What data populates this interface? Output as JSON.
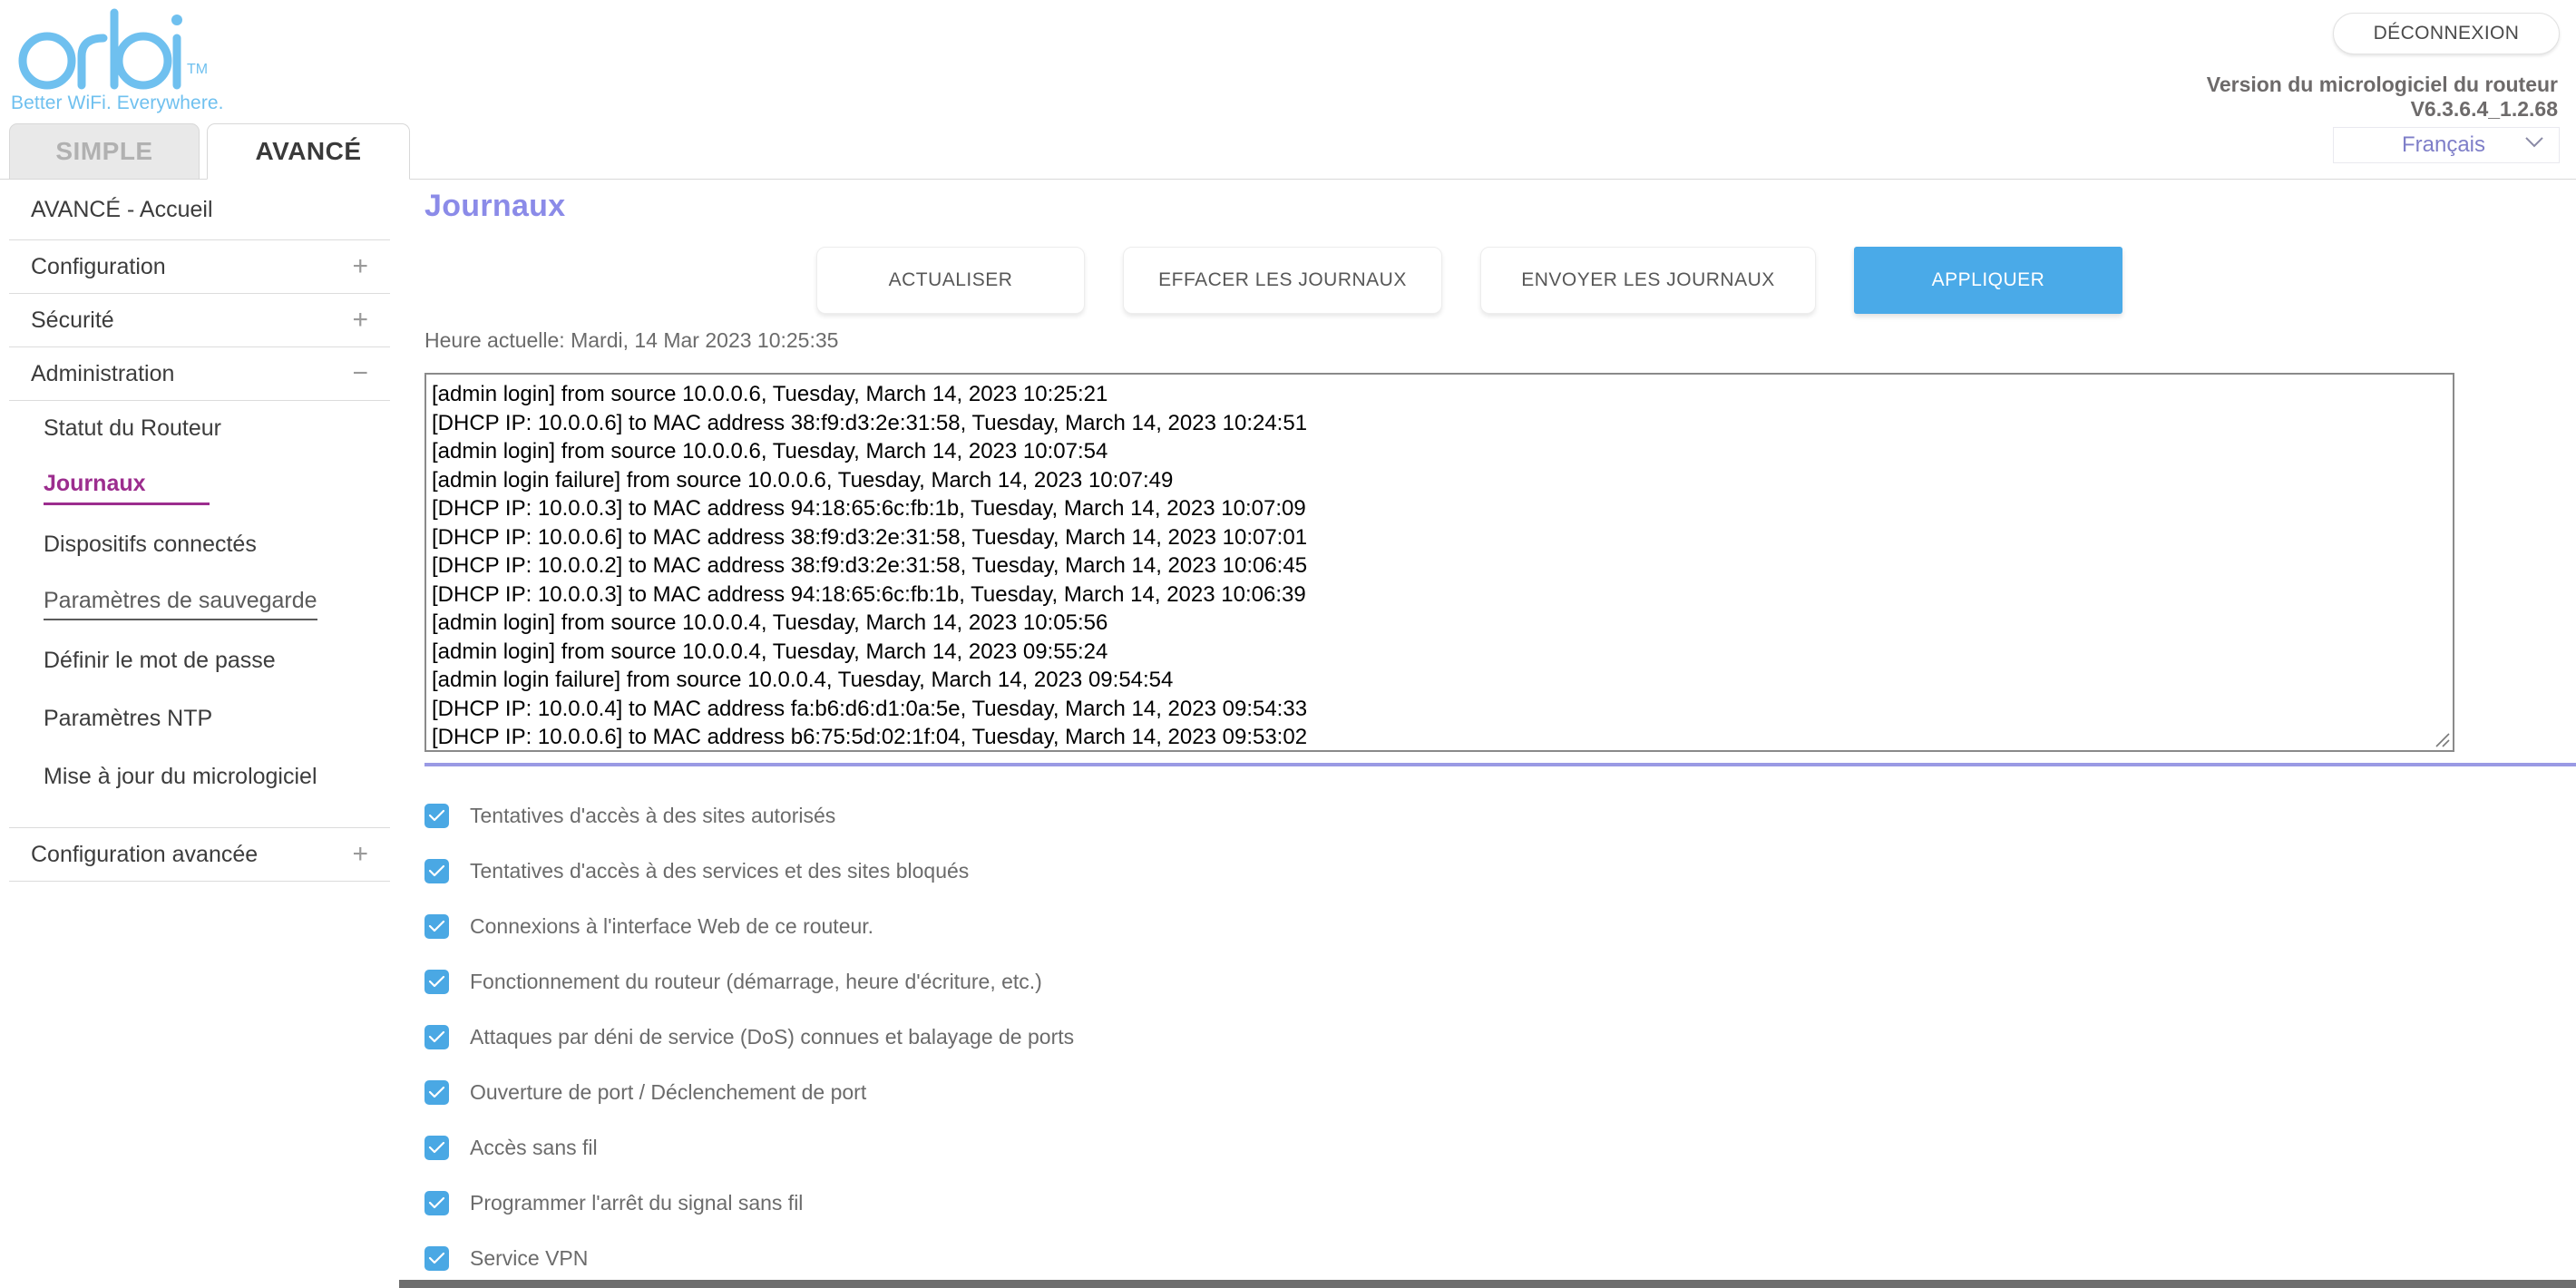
{
  "header": {
    "logo_text": "orbi",
    "logo_tm": "TM",
    "tagline": "Better WiFi. Everywhere.",
    "logout_label": "DÉCONNEXION",
    "firmware_label": "Version du micrologiciel du routeur",
    "firmware_version": "V6.3.6.4_1.2.68",
    "language_selected": "Français",
    "chevron": "⌄",
    "accent_blue": "#6fc0ef"
  },
  "tabs": [
    {
      "label": "SIMPLE",
      "active": false
    },
    {
      "label": "AVANCÉ",
      "active": true
    }
  ],
  "sidebar": {
    "home_label": "AVANCÉ - Accueil",
    "groups": [
      {
        "label": "Configuration",
        "sign": "+"
      },
      {
        "label": "Sécurité",
        "sign": "+"
      },
      {
        "label": "Administration",
        "sign": "−"
      }
    ],
    "admin_items": [
      {
        "label": "Statut du Routeur",
        "state": "normal"
      },
      {
        "label": "Journaux",
        "state": "active"
      },
      {
        "label": "Dispositifs connectés",
        "state": "normal"
      },
      {
        "label": "Paramètres de sauvegarde",
        "state": "hover"
      },
      {
        "label": "Définir le mot de passe",
        "state": "normal"
      },
      {
        "label": "Paramètres NTP",
        "state": "normal"
      },
      {
        "label": "Mise à jour du micrologiciel",
        "state": "normal"
      }
    ],
    "advanced_group": {
      "label": "Configuration avancée",
      "sign": "+"
    },
    "active_color": "#9c2d8e"
  },
  "main": {
    "page_title": "Journaux",
    "page_title_color": "#8b8be8",
    "buttons": [
      {
        "label": "ACTUALISER",
        "primary": false,
        "width_class": "w1"
      },
      {
        "label": "EFFACER LES JOURNAUX",
        "primary": false,
        "width_class": "w2"
      },
      {
        "label": "ENVOYER LES JOURNAUX",
        "primary": false,
        "width_class": "w3"
      },
      {
        "label": "APPLIQUER",
        "primary": true,
        "width_class": "w1"
      }
    ],
    "primary_button_color": "#4aaae8",
    "current_time": "Heure actuelle: Mardi, 14 Mar 2023 10:25:35",
    "log_lines": [
      "[admin login] from source 10.0.0.6, Tuesday, March 14, 2023 10:25:21",
      "[DHCP IP: 10.0.0.6] to MAC address 38:f9:d3:2e:31:58, Tuesday, March 14, 2023 10:24:51",
      "[admin login] from source 10.0.0.6, Tuesday, March 14, 2023 10:07:54",
      "[admin login failure] from source 10.0.0.6, Tuesday, March 14, 2023 10:07:49",
      "[DHCP IP: 10.0.0.3] to MAC address 94:18:65:6c:fb:1b, Tuesday, March 14, 2023 10:07:09",
      "[DHCP IP: 10.0.0.6] to MAC address 38:f9:d3:2e:31:58, Tuesday, March 14, 2023 10:07:01",
      "[DHCP IP: 10.0.0.2] to MAC address 38:f9:d3:2e:31:58, Tuesday, March 14, 2023 10:06:45",
      "[DHCP IP: 10.0.0.3] to MAC address 94:18:65:6c:fb:1b, Tuesday, March 14, 2023 10:06:39",
      "[admin login] from source 10.0.0.4, Tuesday, March 14, 2023 10:05:56",
      "[admin login] from source 10.0.0.4, Tuesday, March 14, 2023 09:55:24",
      "[admin login failure] from source 10.0.0.4, Tuesday, March 14, 2023 09:54:54",
      "[DHCP IP: 10.0.0.4] to MAC address fa:b6:d6:d1:0a:5e, Tuesday, March 14, 2023 09:54:33",
      "[DHCP IP: 10.0.0.6] to MAC address b6:75:5d:02:1f:04, Tuesday, March 14, 2023 09:53:02"
    ],
    "divider_color": "#9a9ae4",
    "checkbox_color": "#4aa8e4",
    "checkboxes": [
      {
        "label": "Tentatives d'accès à des sites autorisés",
        "checked": true
      },
      {
        "label": "Tentatives d'accès à des services et des sites bloqués",
        "checked": true
      },
      {
        "label": "Connexions à l'interface Web de ce routeur.",
        "checked": true
      },
      {
        "label": "Fonctionnement du routeur (démarrage, heure d'écriture, etc.)",
        "checked": true
      },
      {
        "label": "Attaques par déni de service (DoS) connues et balayage de ports",
        "checked": true
      },
      {
        "label": "Ouverture de port / Déclenchement de port",
        "checked": true
      },
      {
        "label": "Accès sans fil",
        "checked": true
      },
      {
        "label": "Programmer l'arrêt du signal sans fil",
        "checked": true
      },
      {
        "label": "Service VPN",
        "checked": true
      }
    ]
  }
}
